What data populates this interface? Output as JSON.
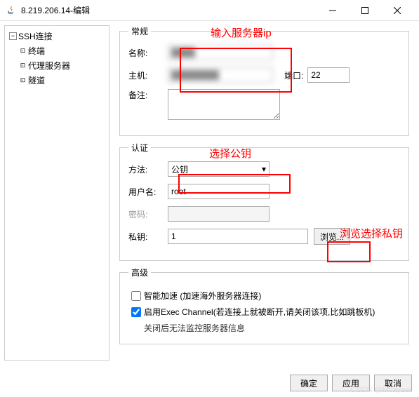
{
  "window": {
    "title": "8.219.206.14-编辑"
  },
  "sidebar": {
    "root": "SSH连接",
    "items": [
      "终端",
      "代理服务器",
      "隧道"
    ]
  },
  "general": {
    "legend": "常规",
    "name_label": "名称:",
    "name_value": "████",
    "host_label": "主机:",
    "host_value": "████████",
    "port_label": "端口:",
    "port_value": "22",
    "remark_label": "备注:"
  },
  "auth": {
    "legend": "认证",
    "method_label": "方法:",
    "method_value": "公钥",
    "user_label": "用户名:",
    "user_value": "root",
    "pass_label": "密码:",
    "key_label": "私钥:",
    "key_value": "1",
    "browse": "浏览..."
  },
  "advanced": {
    "legend": "高级",
    "accel": "智能加速 (加速海外服务器连接)",
    "exec": "启用Exec Channel(若连接上就被断开,请关闭该项,比如跳板机)",
    "note": "关闭后无法监控服务器信息"
  },
  "footer": {
    "ok": "确定",
    "apply": "应用",
    "cancel": "取消"
  },
  "annotations": {
    "a1": "输入服务器ip",
    "a2": "选择公钥",
    "a3": "浏览选择私钥"
  },
  "watermark": "CSDN @Mcayear"
}
